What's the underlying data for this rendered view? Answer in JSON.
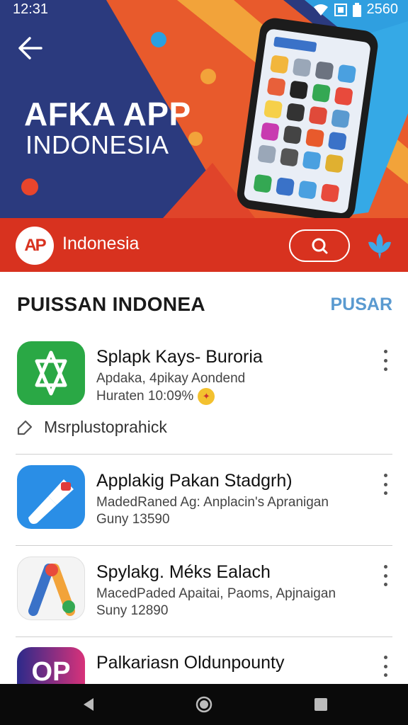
{
  "status": {
    "time": "12:31",
    "battery_text": "2560"
  },
  "hero": {
    "title": "AFKA APP",
    "subtitle": "INDONESIA"
  },
  "toolbar": {
    "logo_text": "AP",
    "label": "Indonesia"
  },
  "section": {
    "title": "PUISSAN INDONEA",
    "action": "PUSAR"
  },
  "apps": [
    {
      "name": "Splapk Kays- Buroria",
      "desc": "Apdaka, 4pikay Aondend",
      "meta": "Huraten 10:09%"
    },
    {
      "name": "Applakig Pakan Stadgrh)",
      "desc": "MadedRaned Ag: Anplacin's Apranigan",
      "meta": "Guny 13590"
    },
    {
      "name": "Spylakg. Méks Ealach",
      "desc": "MacedPaded Apaitai, Paoms, Apjnaigan",
      "meta": "Suny 12890"
    },
    {
      "name": "Palkariasn Oldunpounty",
      "desc": "",
      "meta": ""
    }
  ],
  "tag": {
    "label": "Msrplustoprahick"
  },
  "app4_icon_text": "OP",
  "colors": {
    "accent_red": "#d8321f",
    "hero_blue": "#2b3a7e",
    "link_blue": "#5a9ad0"
  }
}
